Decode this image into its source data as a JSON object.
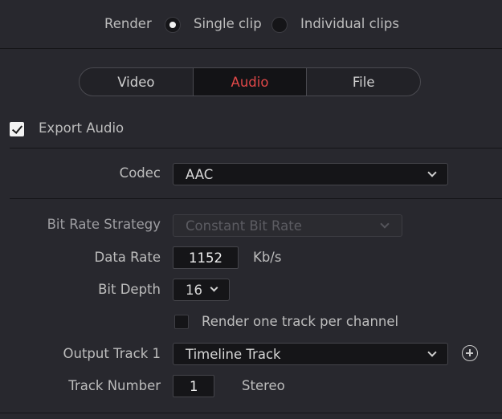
{
  "render": {
    "label": "Render",
    "options": [
      {
        "label": "Single clip",
        "selected": true
      },
      {
        "label": "Individual clips",
        "selected": false
      }
    ]
  },
  "tabs": [
    {
      "label": "Video",
      "active": false
    },
    {
      "label": "Audio",
      "active": true
    },
    {
      "label": "File",
      "active": false
    }
  ],
  "export_audio": {
    "label": "Export Audio",
    "checked": true
  },
  "codec": {
    "label": "Codec",
    "value": "AAC"
  },
  "bit_rate_strategy": {
    "label": "Bit Rate Strategy",
    "value": "Constant Bit Rate",
    "disabled": true
  },
  "data_rate": {
    "label": "Data Rate",
    "value": "1152",
    "unit": "Kb/s"
  },
  "bit_depth": {
    "label": "Bit Depth",
    "value": "16"
  },
  "render_per_channel": {
    "label": "Render one track per channel",
    "checked": false
  },
  "output_track": {
    "label": "Output Track 1",
    "value": "Timeline Track"
  },
  "track_number": {
    "label": "Track Number",
    "value": "1",
    "channel": "Stereo"
  },
  "colors": {
    "accent": "#e04848",
    "background": "#28282e",
    "field": "#151518"
  }
}
